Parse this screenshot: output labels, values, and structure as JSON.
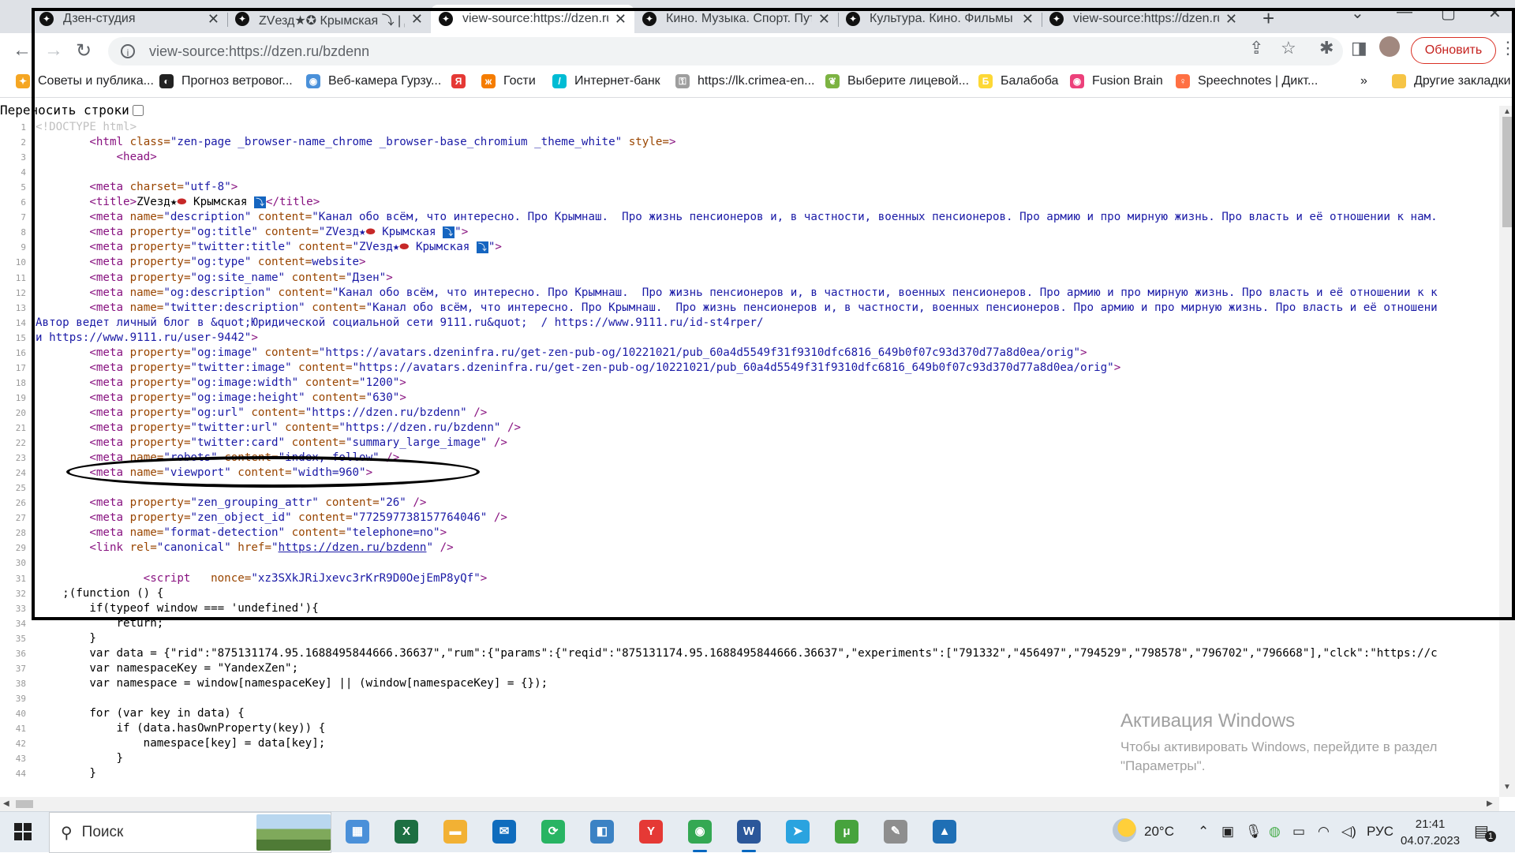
{
  "tabs": [
    {
      "title": "Дзен-студия",
      "icon": "dzen-icon",
      "active": false
    },
    {
      "title": "ZVезд★✪ Крымская ⤵ | Дз",
      "icon": "dzen-icon",
      "active": false
    },
    {
      "title": "view-source:https://dzen.ru",
      "icon": "dzen-icon",
      "active": true
    },
    {
      "title": "Кино. Музыка. Спорт. Путе",
      "icon": "dzen-icon",
      "active": false
    },
    {
      "title": "Культура. Кино. Фильмы с",
      "icon": "dzen-icon",
      "active": false
    },
    {
      "title": "view-source:https://dzen.ru",
      "icon": "dzen-icon",
      "active": false
    }
  ],
  "toolbar": {
    "url": "view-source:https://dzen.ru/bzdenn",
    "update_label": "Обновить"
  },
  "bookmarks": [
    {
      "label": "Советы и публика...",
      "color": "#f5a623",
      "glyph": "✦"
    },
    {
      "label": "Прогноз ветровог...",
      "color": "#222222",
      "glyph": "◐"
    },
    {
      "label": "Веб-камера Гурзу...",
      "color": "#4a90d9",
      "glyph": "◉"
    },
    {
      "label": "",
      "color": "#e53935",
      "glyph": "Я"
    },
    {
      "label": "Гости",
      "color": "#f57c00",
      "glyph": "ж"
    },
    {
      "label": "Интернет-банк",
      "color": "#00bcd4",
      "glyph": "/"
    },
    {
      "label": "https://lk.crimea-en...",
      "color": "#9e9e9e",
      "glyph": "⚿"
    },
    {
      "label": "Выберите лицевой...",
      "color": "#7cb342",
      "glyph": "❦"
    },
    {
      "label": "Балабоба",
      "color": "#fdd835",
      "glyph": "Б"
    },
    {
      "label": "Fusion Brain",
      "color": "#ec407a",
      "glyph": "◉"
    },
    {
      "label": "Speechnotes | Дикт...",
      "color": "#ff7043",
      "glyph": "♀"
    }
  ],
  "bookmarks_more": "»",
  "bookmarks_other": "Другие закладки",
  "wrap_label": "Переносить строки",
  "source_lines": [
    {
      "n": "1",
      "html": "<span class='t-doc'>&lt;!DOCTYPE html&gt;</span>"
    },
    {
      "n": "2",
      "html": "        <span class='t-tag'>&lt;html</span> <span class='t-attr'>class=</span><span class='t-val'>\"zen-page _browser-name_chrome _browser-base_chromium _theme_white\"</span> <span class='t-attr'>style=</span><span class='t-tag'>&gt;</span>"
    },
    {
      "n": "3",
      "html": "            <span class='t-tag'>&lt;head&gt;</span>"
    },
    {
      "n": "4",
      "html": ""
    },
    {
      "n": "5",
      "html": "        <span class='t-tag'>&lt;meta</span> <span class='t-attr'>charset=</span><span class='t-val'>\"utf-8\"</span><span class='t-tag'>&gt;</span>"
    },
    {
      "n": "6",
      "html": "        <span class='t-tag'>&lt;title&gt;</span><span class='t-txt'>ZVезд★<span class='badge-red'>⬬</span> Крымская <span class='emoji-box'>⤵</span></span><span class='t-tag'>&lt;/title&gt;</span>"
    },
    {
      "n": "7",
      "html": "        <span class='t-tag'>&lt;meta</span> <span class='t-attr'>name=</span><span class='t-val'>\"description\"</span> <span class='t-attr'>content=</span><span class='t-val'>\"Канал обо всём, что интересно. Про Крымнаш.  Про жизнь пенсионеров и, в частности, военных пенсионеров. Про армию и про мирную жизнь. Про власть и её отношении к нам.</span>"
    },
    {
      "n": "8",
      "html": "        <span class='t-tag'>&lt;meta</span> <span class='t-attr'>property=</span><span class='t-val'>\"og:title\"</span> <span class='t-attr'>content=</span><span class='t-val'>\"ZVезд★<span class='badge-red'>⬬</span> Крымская <span class='emoji-box'>⤵</span>\"</span><span class='t-tag'>&gt;</span>"
    },
    {
      "n": "9",
      "html": "        <span class='t-tag'>&lt;meta</span> <span class='t-attr'>property=</span><span class='t-val'>\"twitter:title\"</span> <span class='t-attr'>content=</span><span class='t-val'>\"ZVезд★<span class='badge-red'>⬬</span> Крымская <span class='emoji-box'>⤵</span>\"</span><span class='t-tag'>&gt;</span>"
    },
    {
      "n": "10",
      "html": "        <span class='t-tag'>&lt;meta</span> <span class='t-attr'>property=</span><span class='t-val'>\"og:type\"</span> <span class='t-attr'>content=</span><span class='t-val'>website</span><span class='t-tag'>&gt;</span>"
    },
    {
      "n": "11",
      "html": "        <span class='t-tag'>&lt;meta</span> <span class='t-attr'>property=</span><span class='t-val'>\"og:site_name\"</span> <span class='t-attr'>content=</span><span class='t-val'>\"Дзен\"</span><span class='t-tag'>&gt;</span>"
    },
    {
      "n": "12",
      "html": "        <span class='t-tag'>&lt;meta</span> <span class='t-attr'>name=</span><span class='t-val'>\"og:description\"</span> <span class='t-attr'>content=</span><span class='t-val'>\"Канал обо всём, что интересно. Про Крымнаш.  Про жизнь пенсионеров и, в частности, военных пенсионеров. Про армию и про мирную жизнь. Про власть и её отношении к к</span>"
    },
    {
      "n": "13",
      "html": "        <span class='t-tag'>&lt;meta</span> <span class='t-attr'>name=</span><span class='t-val'>\"twitter:description\"</span> <span class='t-attr'>content=</span><span class='t-val'>\"Канал обо всём, что интересно. Про Крымнаш.  Про жизнь пенсионеров и, в частности, военных пенсионеров. Про армию и про мирную жизнь. Про власть и её отношени</span>"
    },
    {
      "n": "14",
      "html": "<span class='t-val'>Автор ведет личный блог в &amp;quot;Юридической социальной сети 9111.ru&amp;quot;  / https://www.9111.ru/id-st4rper/</span>"
    },
    {
      "n": "15",
      "html": "<span class='t-val'>и https://www.9111.ru/user-9442\"</span><span class='t-tag'>&gt;</span>"
    },
    {
      "n": "16",
      "html": "        <span class='t-tag'>&lt;meta</span> <span class='t-attr'>property=</span><span class='t-val'>\"og:image\"</span> <span class='t-attr'>content=</span><span class='t-val'>\"https://avatars.dzeninfra.ru/get-zen-pub-og/10221021/pub_60a4d5549f31f9310dfc6816_649b0f07c93d370d77a8d0ea/orig\"</span><span class='t-tag'>&gt;</span>"
    },
    {
      "n": "17",
      "html": "        <span class='t-tag'>&lt;meta</span> <span class='t-attr'>property=</span><span class='t-val'>\"twitter:image\"</span> <span class='t-attr'>content=</span><span class='t-val'>\"https://avatars.dzeninfra.ru/get-zen-pub-og/10221021/pub_60a4d5549f31f9310dfc6816_649b0f07c93d370d77a8d0ea/orig\"</span><span class='t-tag'>&gt;</span>"
    },
    {
      "n": "18",
      "html": "        <span class='t-tag'>&lt;meta</span> <span class='t-attr'>property=</span><span class='t-val'>\"og:image:width\"</span> <span class='t-attr'>content=</span><span class='t-val'>\"1200\"</span><span class='t-tag'>&gt;</span>"
    },
    {
      "n": "19",
      "html": "        <span class='t-tag'>&lt;meta</span> <span class='t-attr'>property=</span><span class='t-val'>\"og:image:height\"</span> <span class='t-attr'>content=</span><span class='t-val'>\"630\"</span><span class='t-tag'>&gt;</span>"
    },
    {
      "n": "20",
      "html": "        <span class='t-tag'>&lt;meta</span> <span class='t-attr'>property=</span><span class='t-val'>\"og:url\"</span> <span class='t-attr'>content=</span><span class='t-val'>\"https://dzen.ru/bzdenn\"</span> <span class='t-tag'>/&gt;</span>"
    },
    {
      "n": "21",
      "html": "        <span class='t-tag'>&lt;meta</span> <span class='t-attr'>property=</span><span class='t-val'>\"twitter:url\"</span> <span class='t-attr'>content=</span><span class='t-val'>\"https://dzen.ru/bzdenn\"</span> <span class='t-tag'>/&gt;</span>"
    },
    {
      "n": "22",
      "html": "        <span class='t-tag'>&lt;meta</span> <span class='t-attr'>property=</span><span class='t-val'>\"twitter:card\"</span> <span class='t-attr'>content=</span><span class='t-val'>\"summary_large_image\"</span> <span class='t-tag'>/&gt;</span>"
    },
    {
      "n": "23",
      "html": "        <span class='t-tag'>&lt;meta</span> <span class='t-attr'>name=</span><span class='t-val'>\"robots\"</span> <span class='t-attr'>content=</span><span class='t-val'>\"index, follow\"</span> <span class='t-tag'>/&gt;</span>"
    },
    {
      "n": "24",
      "html": "        <span class='t-tag'>&lt;meta</span> <span class='t-attr'>name=</span><span class='t-val'>\"viewport\"</span> <span class='t-attr'>content=</span><span class='t-val'>\"width=960\"</span><span class='t-tag'>&gt;</span>"
    },
    {
      "n": "25",
      "html": ""
    },
    {
      "n": "26",
      "html": "        <span class='t-tag'>&lt;meta</span> <span class='t-attr'>property=</span><span class='t-val'>\"zen_grouping_attr\"</span> <span class='t-attr'>content=</span><span class='t-val'>\"26\"</span> <span class='t-tag'>/&gt;</span>"
    },
    {
      "n": "27",
      "html": "        <span class='t-tag'>&lt;meta</span> <span class='t-attr'>property=</span><span class='t-val'>\"zen_object_id\"</span> <span class='t-attr'>content=</span><span class='t-val'>\"772597738157764046\"</span> <span class='t-tag'>/&gt;</span>"
    },
    {
      "n": "28",
      "html": "        <span class='t-tag'>&lt;meta</span> <span class='t-attr'>name=</span><span class='t-val'>\"format-detection\"</span> <span class='t-attr'>content=</span><span class='t-val'>\"telephone=no\"</span><span class='t-tag'>&gt;</span>"
    },
    {
      "n": "29",
      "html": "        <span class='t-tag'>&lt;link</span> <span class='t-attr'>rel=</span><span class='t-val'>\"canonical\"</span> <span class='t-attr'>href=</span><span class='t-val'>\"<span class='t-link'>https://dzen.ru/bzdenn</span>\"</span> <span class='t-tag'>/&gt;</span>"
    },
    {
      "n": "30",
      "html": ""
    },
    {
      "n": "31",
      "html": "                <span class='t-tag'>&lt;script</span>   <span class='t-attr'>nonce=</span><span class='t-val'>\"xz3SXkJRiJxevc3rKrR9D0OejEmP8yQf\"</span><span class='t-tag'>&gt;</span>"
    },
    {
      "n": "32",
      "html": "    ;(function () {"
    },
    {
      "n": "33",
      "html": "        if(typeof window === 'undefined'){"
    },
    {
      "n": "34",
      "html": "            return;"
    },
    {
      "n": "35",
      "html": "        }"
    },
    {
      "n": "36",
      "html": "        var data = {\"rid\":\"875131174.95.1688495844666.36637\",\"rum\":{\"params\":{\"reqid\":\"875131174.95.1688495844666.36637\",\"experiments\":[\"791332\",\"456497\",\"794529\",\"798578\",\"796702\",\"796668\"],\"clck\":\"https://c"
    },
    {
      "n": "37",
      "html": "        var namespaceKey = \"YandexZen\";"
    },
    {
      "n": "38",
      "html": "        var namespace = window[namespaceKey] || (window[namespaceKey] = {});"
    },
    {
      "n": "39",
      "html": ""
    },
    {
      "n": "40",
      "html": "        for (var key in data) {"
    },
    {
      "n": "41",
      "html": "            if (data.hasOwnProperty(key)) {"
    },
    {
      "n": "42",
      "html": "                namespace[key] = data[key];"
    },
    {
      "n": "43",
      "html": "            }"
    },
    {
      "n": "44",
      "html": "        }"
    }
  ],
  "watermark": {
    "title": "Активация Windows",
    "subtitle": "Чтобы активировать Windows, перейдите в раздел \"Параметры\"."
  },
  "taskbar": {
    "search_placeholder": "Поиск",
    "apps": [
      {
        "name": "calculator-app-icon",
        "color": "#4a90d9",
        "glyph": "▦",
        "running": false
      },
      {
        "name": "excel-app-icon",
        "color": "#1d6f42",
        "glyph": "X",
        "running": false
      },
      {
        "name": "file-explorer-app-icon",
        "color": "#f2b134",
        "glyph": "▬",
        "running": false
      },
      {
        "name": "mail-app-icon",
        "color": "#0f6cbd",
        "glyph": "✉",
        "running": false
      },
      {
        "name": "green-app-icon",
        "color": "#28b463",
        "glyph": "⟳",
        "running": false
      },
      {
        "name": "meeting-app-icon",
        "color": "#3b82c4",
        "glyph": "◧",
        "running": false
      },
      {
        "name": "yandex-browser-icon",
        "color": "#e53935",
        "glyph": "Y",
        "running": false
      },
      {
        "name": "chrome-app-icon",
        "color": "#34a853",
        "glyph": "◉",
        "running": true
      },
      {
        "name": "word-app-icon",
        "color": "#2b579a",
        "glyph": "W",
        "running": true
      },
      {
        "name": "telegram-app-icon",
        "color": "#2aa3df",
        "glyph": "➤",
        "running": false
      },
      {
        "name": "utorrent-app-icon",
        "color": "#47a33d",
        "glyph": "μ",
        "running": false
      },
      {
        "name": "paint-app-icon",
        "color": "#8e8e8e",
        "glyph": "✎",
        "running": false
      },
      {
        "name": "photos-app-icon",
        "color": "#1f6fb5",
        "glyph": "▲",
        "running": false
      }
    ],
    "temperature": "20°C",
    "language": "РУС",
    "time": "21:41",
    "date": "04.07.2023",
    "notification_count": "1"
  }
}
